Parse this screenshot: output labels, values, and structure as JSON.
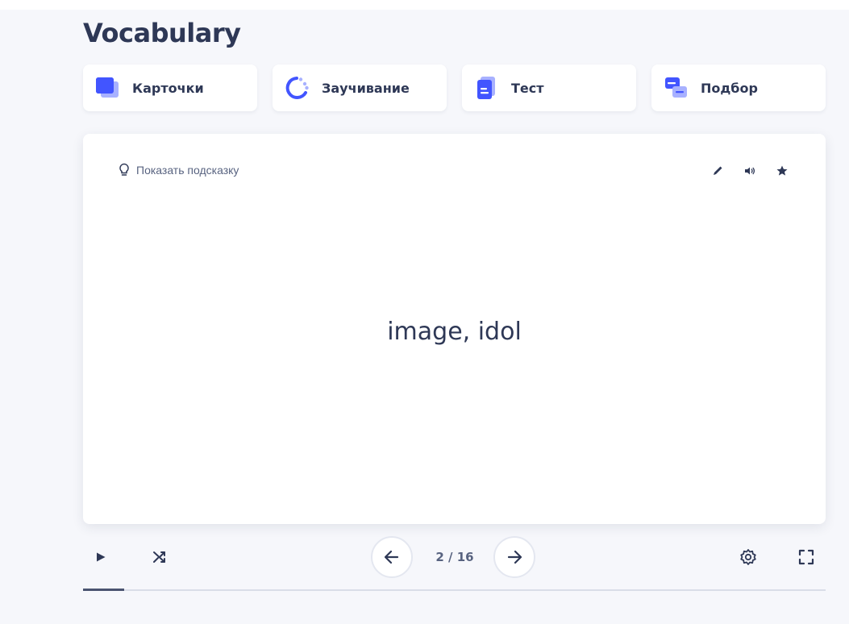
{
  "page": {
    "title": "Vocabulary"
  },
  "modes": [
    {
      "label": "Карточки",
      "icon": "flashcards-icon"
    },
    {
      "label": "Заучивание",
      "icon": "learn-icon"
    },
    {
      "label": "Тест",
      "icon": "test-icon"
    },
    {
      "label": "Подбор",
      "icon": "match-icon"
    }
  ],
  "card": {
    "hint_label": "Показать подсказку",
    "term": "image, idol",
    "actions": [
      "edit-icon",
      "audio-icon",
      "star-icon"
    ]
  },
  "controls": {
    "current": 2,
    "total": 16,
    "counter_text": "2 / 16",
    "progress": 0.055
  },
  "colors": {
    "accent": "#4255ff",
    "accent_light": "#a8b1ff",
    "text": "#2e3856",
    "muted": "#586380",
    "background": "#f6f7fb"
  }
}
